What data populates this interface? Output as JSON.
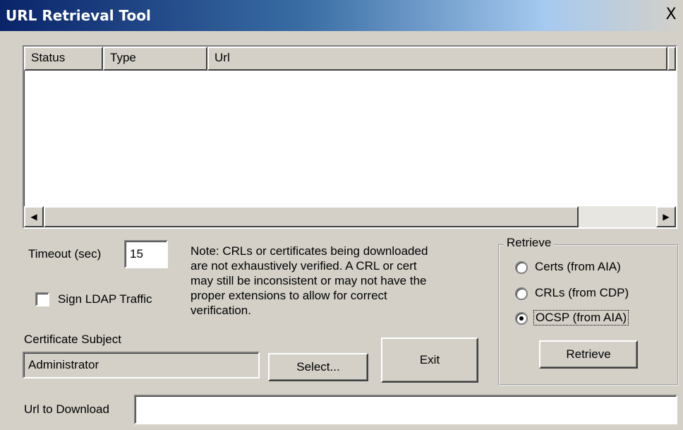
{
  "window": {
    "title": "URL Retrieval Tool",
    "close_glyph": "X"
  },
  "list": {
    "columns": [
      "Status",
      "Type",
      "Url"
    ],
    "rows": []
  },
  "timeout": {
    "label": "Timeout (sec)",
    "value": "15"
  },
  "sign_ldap": {
    "label": "Sign LDAP Traffic",
    "checked": false
  },
  "note": "Note: CRLs or certificates being downloaded\nare not exhaustively verified.  A CRL or cert\nmay still be inconsistent or may not have the\nproper extensions to allow for correct\nverification.",
  "certificate_subject": {
    "label": "Certificate Subject",
    "value": "Administrator"
  },
  "buttons": {
    "select": "Select...",
    "exit": "Exit",
    "retrieve": "Retrieve"
  },
  "retrieve_group": {
    "legend": "Retrieve",
    "options": [
      {
        "label": "Certs (from AIA)",
        "selected": false
      },
      {
        "label": "CRLs (from CDP)",
        "selected": false
      },
      {
        "label": "OCSP (from AIA)",
        "selected": true
      }
    ]
  },
  "url_to_download": {
    "label": "Url to Download",
    "value": ""
  }
}
